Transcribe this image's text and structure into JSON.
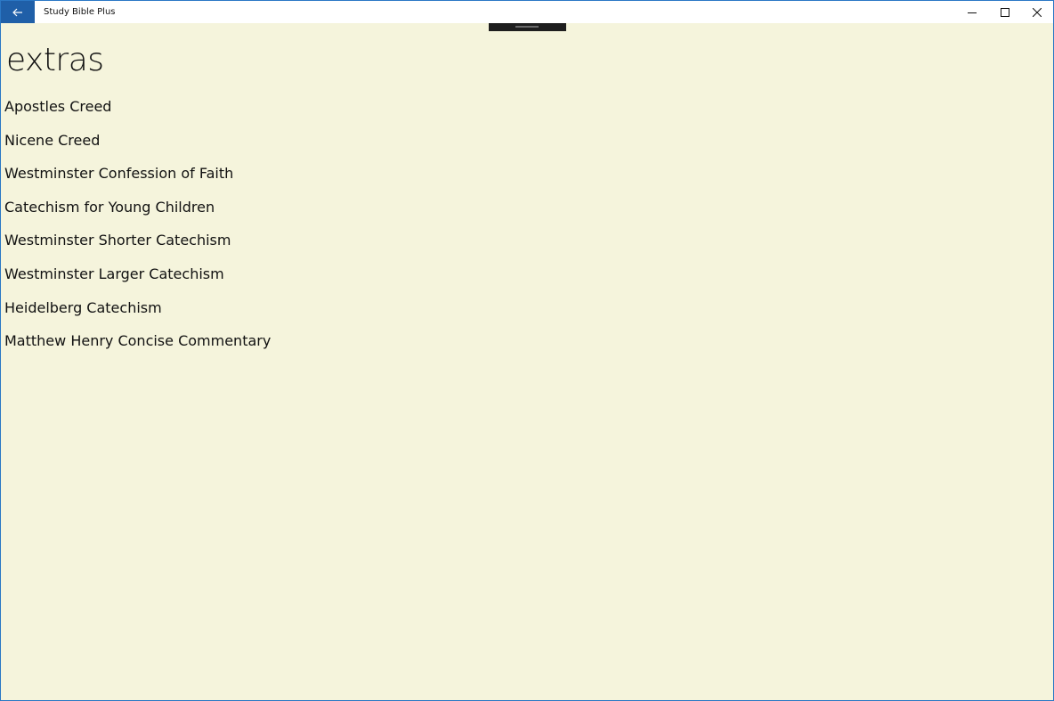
{
  "window": {
    "app_title": "Study Bible Plus",
    "back_icon": "arrow-left-icon",
    "minimize_icon": "minimize-icon",
    "maximize_icon": "maximize-icon",
    "close_icon": "close-icon"
  },
  "page": {
    "title": "extras"
  },
  "extras": [
    {
      "label": "Apostles Creed"
    },
    {
      "label": "Nicene Creed"
    },
    {
      "label": "Westminster Confession of Faith"
    },
    {
      "label": "Catechism for Young Children"
    },
    {
      "label": "Westminster Shorter Catechism"
    },
    {
      "label": "Westminster Larger Catechism"
    },
    {
      "label": "Heidelberg Catechism"
    },
    {
      "label": "Matthew Henry Concise Commentary"
    }
  ],
  "colors": {
    "accent": "#1f5fa8",
    "background": "#f5f4dc",
    "text": "#111111"
  }
}
